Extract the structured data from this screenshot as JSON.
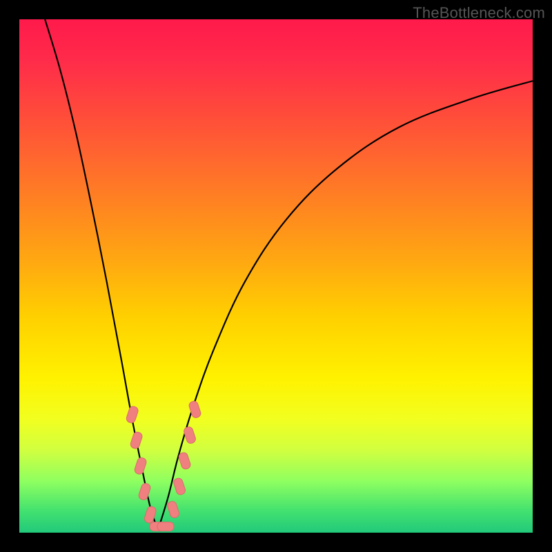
{
  "watermark": "TheBottleneck.com",
  "colors": {
    "frame_bg": "#000000",
    "curve": "#000000",
    "marker_fill": "#f08080",
    "marker_stroke": "#d96b6b",
    "gradient_stops": [
      "#ff1a4b",
      "#ff4a3b",
      "#ff8a1e",
      "#ffd000",
      "#fff200",
      "#d0ff40",
      "#40e070",
      "#22c97a"
    ]
  },
  "chart_data": {
    "type": "line",
    "title": "",
    "xlabel": "",
    "ylabel": "",
    "x_range": [
      0,
      100
    ],
    "y_range": [
      0,
      100
    ],
    "description": "V-shaped bottleneck curve with minimum near x≈27; left branch starts at top-left corner, right branch rises toward upper-right.",
    "minimum_x": 27,
    "curve_left": {
      "comment": "Left descending branch (x from ~5 to 27). y in percent of plot height from top.",
      "x": [
        5,
        8,
        11,
        14,
        17,
        20,
        22,
        24,
        25.5,
        27
      ],
      "y": [
        100,
        90,
        78,
        64,
        49,
        33,
        22,
        12,
        5,
        0.5
      ]
    },
    "curve_right": {
      "comment": "Right ascending branch (x from 27 to 100). y in percent of plot height from top.",
      "x": [
        27,
        29,
        31,
        34,
        38,
        44,
        52,
        62,
        74,
        88,
        100
      ],
      "y": [
        0.5,
        7,
        15,
        25,
        36,
        49,
        61,
        71,
        79,
        84.5,
        88
      ]
    },
    "markers": {
      "comment": "Pink/salmon rounded markers clustered near the minimum on both branches",
      "points": [
        {
          "x": 22.0,
          "y": 23
        },
        {
          "x": 22.8,
          "y": 18
        },
        {
          "x": 23.6,
          "y": 13
        },
        {
          "x": 24.4,
          "y": 8
        },
        {
          "x": 25.5,
          "y": 3.5
        },
        {
          "x": 27.0,
          "y": 1.2
        },
        {
          "x": 28.5,
          "y": 1.2
        },
        {
          "x": 30.0,
          "y": 4.5
        },
        {
          "x": 31.2,
          "y": 9
        },
        {
          "x": 32.2,
          "y": 14
        },
        {
          "x": 33.2,
          "y": 19
        },
        {
          "x": 34.2,
          "y": 24
        }
      ]
    }
  }
}
